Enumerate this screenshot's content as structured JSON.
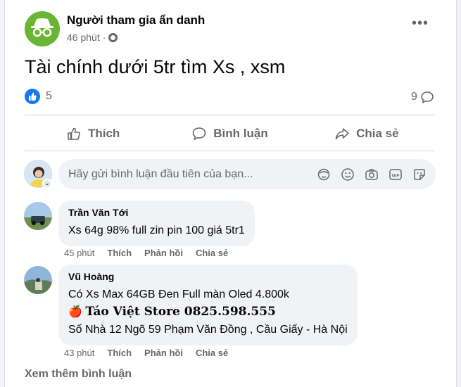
{
  "post": {
    "author": "Người tham gia ẩn danh",
    "time": "46 phút",
    "separator": "·",
    "more": "•••",
    "text": "Tài chính dưới 5tr tìm Xs , xsm",
    "reaction_count": "5",
    "comment_count": "9"
  },
  "actions": {
    "like": "Thích",
    "comment": "Bình luận",
    "share": "Chia sẻ"
  },
  "composer": {
    "placeholder": "Hãy gửi bình luận đầu tiên của bạn...",
    "icons": [
      "avatar-sticker-icon",
      "emoji-icon",
      "camera-icon",
      "gif-icon",
      "sticker-icon"
    ]
  },
  "comments": [
    {
      "name": "Trần Văn Tới",
      "lines": [
        "Xs 64g 98% full zin pin 100 giá 5tr1"
      ],
      "time": "45 phút",
      "like": "Thích",
      "reply": "Phản hồi",
      "share": "Chia sẻ"
    },
    {
      "name": "Vũ Hoàng",
      "line1": "Có Xs Max 64GB Đen Full màn Oled 4.800k",
      "store_emoji": "🍎",
      "store": "Táo Việt Store 0825.598.555",
      "line3": "Số Nhà 12 Ngõ 59 Phạm Văn Đồng , Cầu Giấy - Hà Nội",
      "time": "43 phút",
      "like": "Thích",
      "reply": "Phản hồi",
      "share": "Chia sẻ"
    }
  ],
  "view_more": "Xem thêm bình luận",
  "colors": {
    "accent": "#1877f2",
    "muted": "#65676b",
    "bubble": "#f0f2f5"
  }
}
